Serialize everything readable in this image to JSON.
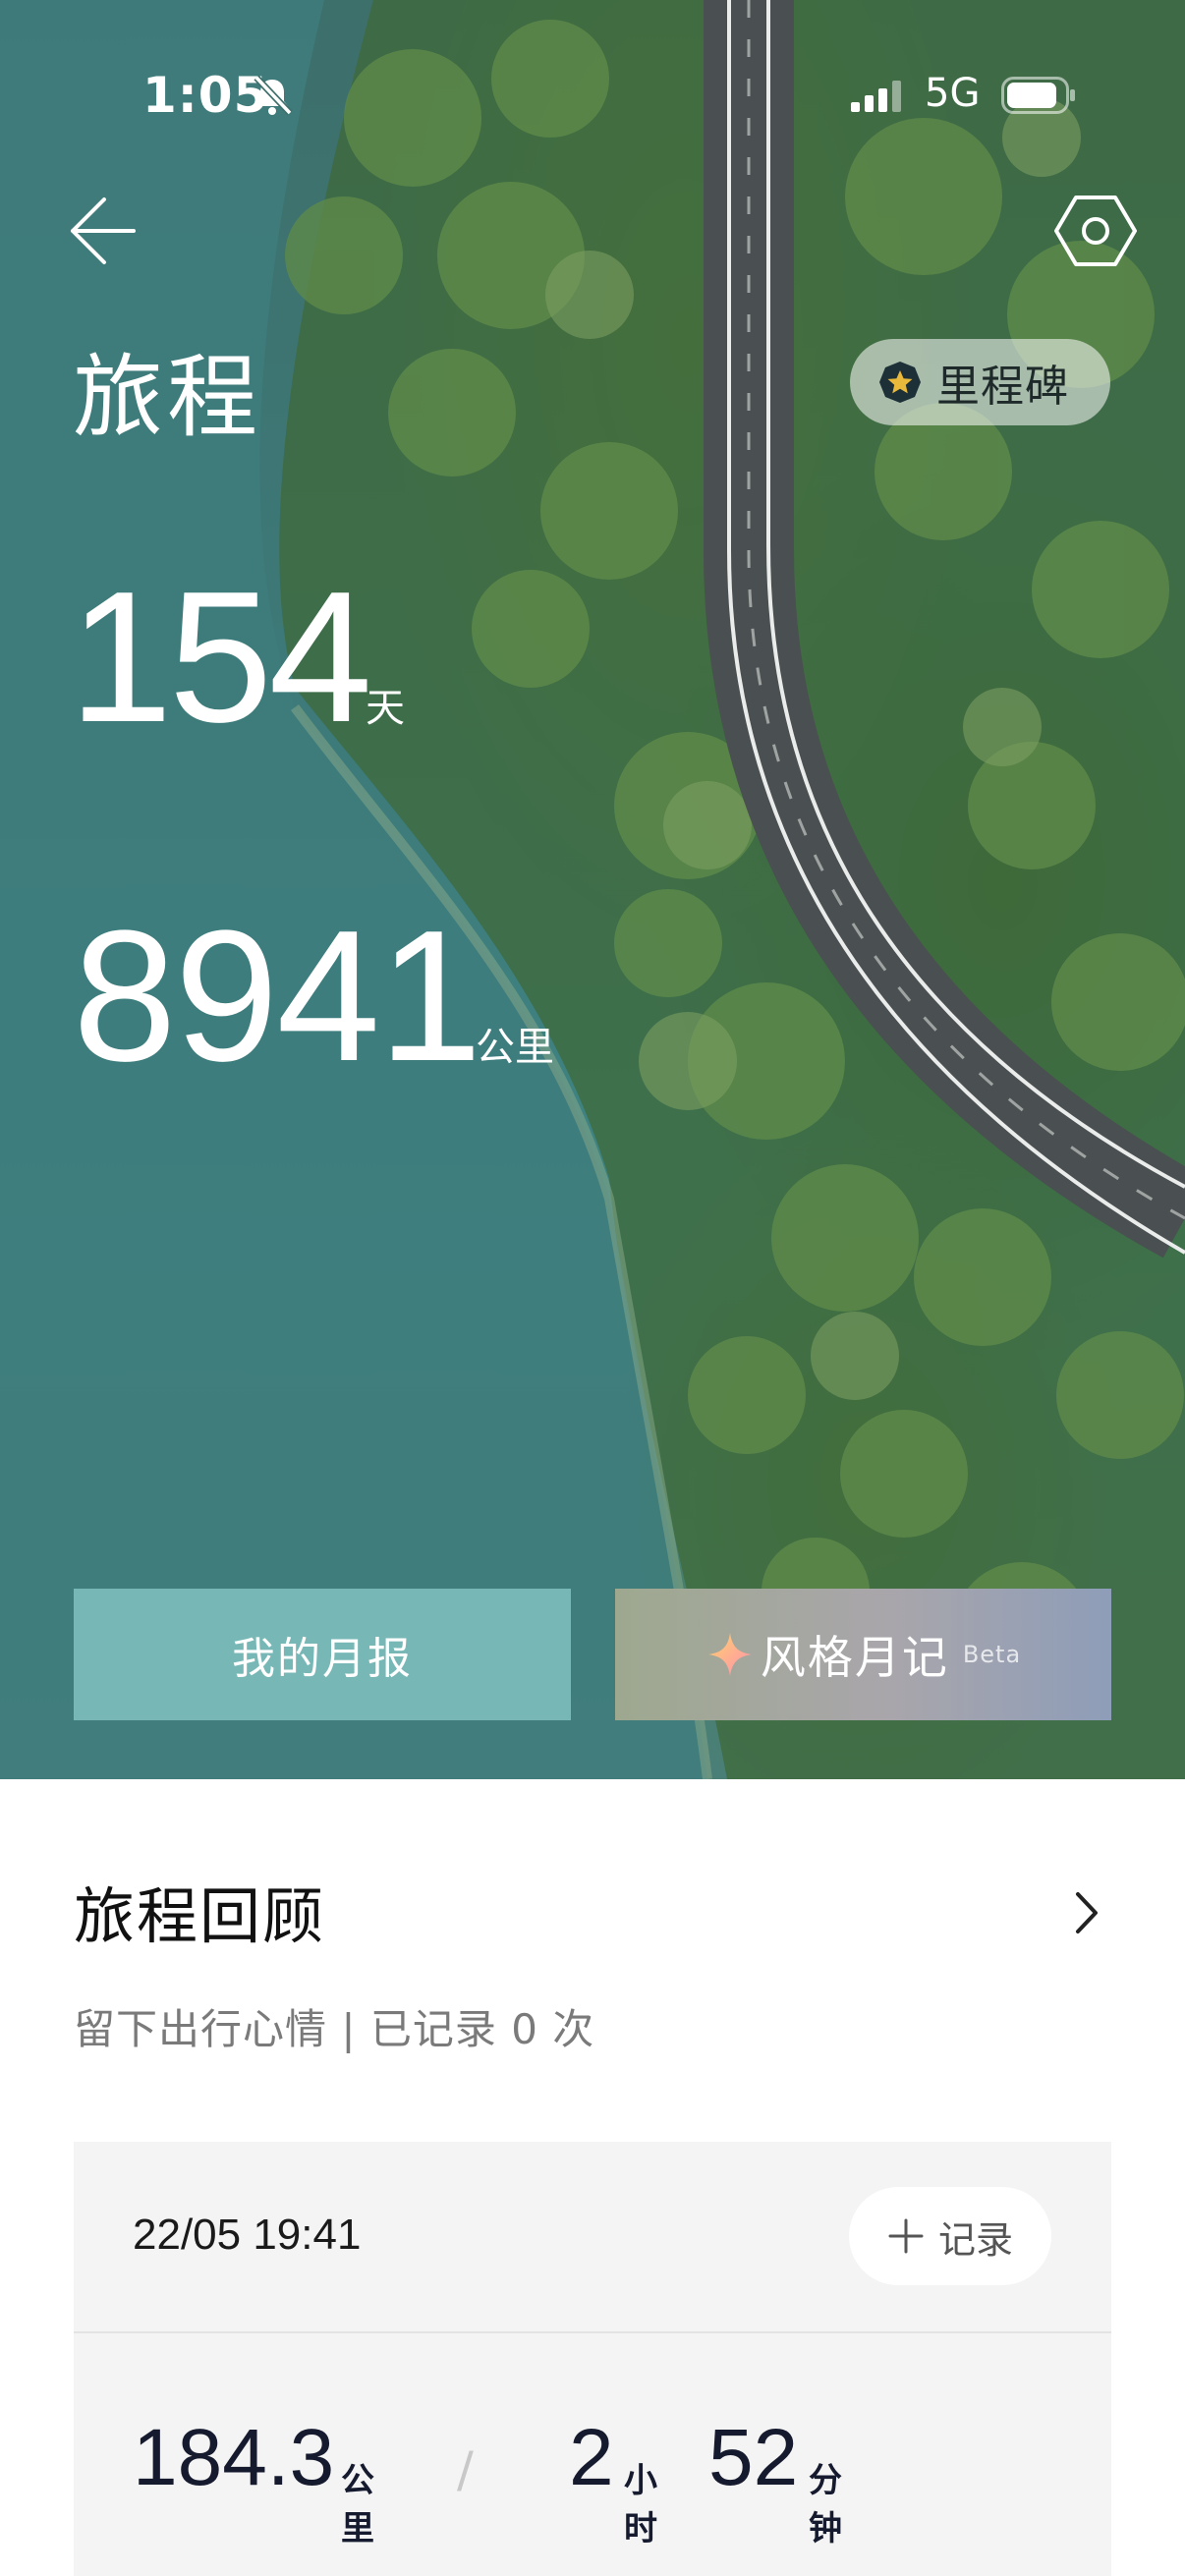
{
  "status_bar": {
    "time": "1:05",
    "network": "5G",
    "icons": [
      "bell-muted-icon",
      "signal-icon",
      "battery-icon"
    ]
  },
  "header": {
    "title": "旅程",
    "milestone_label": "里程碑",
    "icons": [
      "back-arrow-icon",
      "settings-hexagon-icon",
      "star-badge-icon"
    ]
  },
  "stats": {
    "days_value": "154",
    "days_unit": "天",
    "distance_value": "8941",
    "distance_unit": "公里"
  },
  "actions": {
    "monthly_report": "我的月报",
    "style_diary": "风格月记",
    "style_diary_badge": "Beta"
  },
  "review": {
    "title": "旅程回顾",
    "subtitle": "留下出行心情 | 已记录 0 次"
  },
  "trip": {
    "datetime": "22/05 19:41",
    "record_label": "记录",
    "distance": "184.3",
    "distance_unit": "公里",
    "separator": "/",
    "hours": "2",
    "hours_unit": "小时",
    "minutes": "52",
    "minutes_unit": "分钟"
  },
  "colors": {
    "monthly_button": "#77b8b6",
    "lake": "#3d7a79",
    "forest": "#4c7a45"
  }
}
